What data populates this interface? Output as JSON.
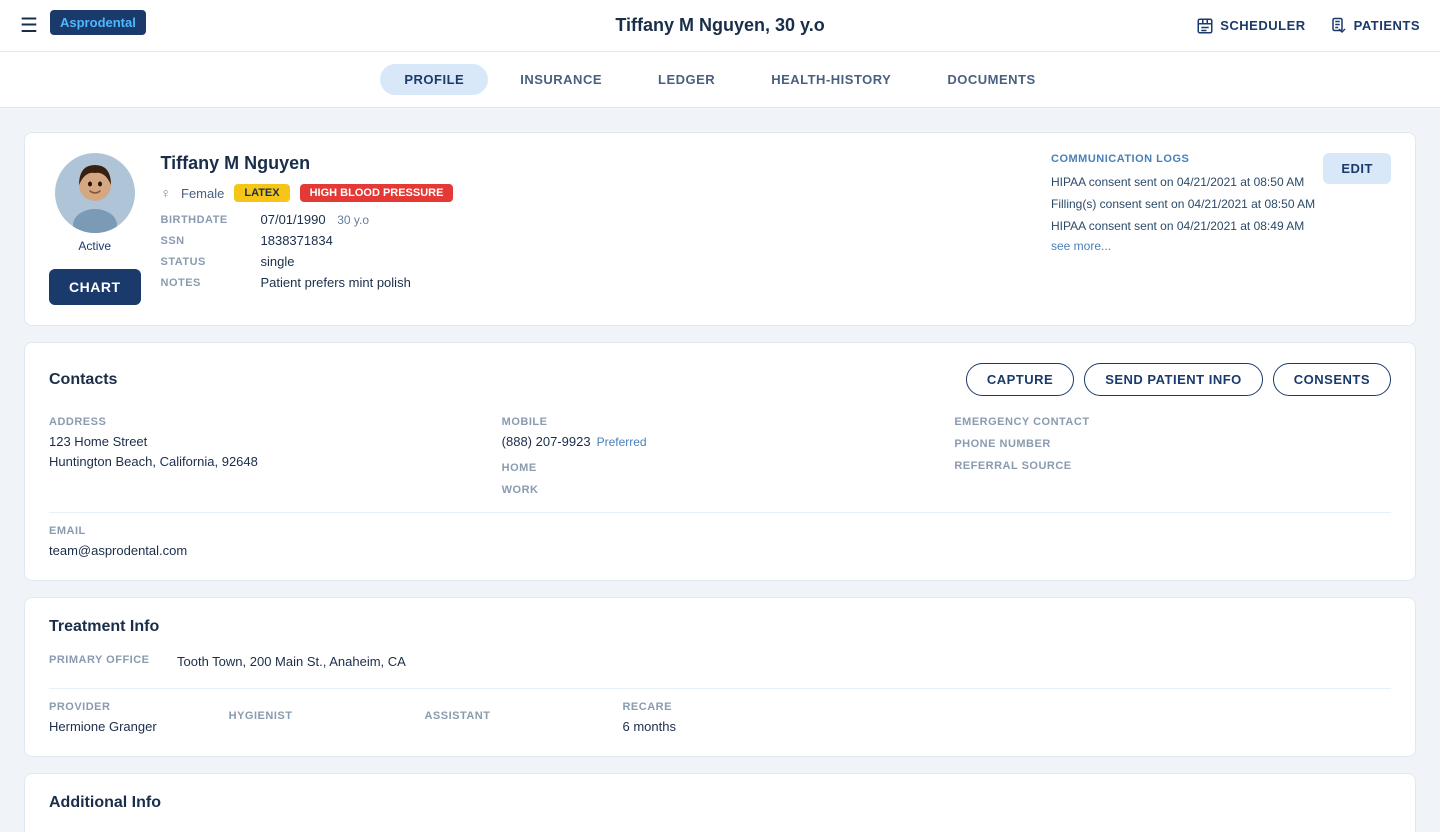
{
  "app": {
    "logo_text": "Aspro",
    "logo_accent": "dental",
    "hamburger_icon": "☰",
    "patient_title": "Tiffany M Nguyen, 30 y.o"
  },
  "nav": {
    "scheduler_label": "SCHEDULER",
    "patients_label": "PATIENTS"
  },
  "tabs": [
    {
      "id": "profile",
      "label": "PROFILE",
      "active": true
    },
    {
      "id": "insurance",
      "label": "INSURANCE",
      "active": false
    },
    {
      "id": "ledger",
      "label": "LEDGER",
      "active": false
    },
    {
      "id": "health-history",
      "label": "HEALTH-HISTORY",
      "active": false
    },
    {
      "id": "documents",
      "label": "DOCUMENTS",
      "active": false
    }
  ],
  "patient": {
    "name": "Tiffany M Nguyen",
    "status": "Active",
    "gender_icon": "♀",
    "gender": "Female",
    "badge_latex": "LATEX",
    "badge_bp": "HIGH BLOOD PRESSURE",
    "birthdate_label": "BIRTHDATE",
    "birthdate": "07/01/1990",
    "age": "30 y.o",
    "ssn_label": "SSN",
    "ssn": "1838371834",
    "status_label": "STATUS",
    "marital_status": "single",
    "notes_label": "NOTES",
    "notes": "Patient prefers mint polish",
    "chart_btn": "CHART"
  },
  "comm_logs": {
    "title": "COMMUNICATION LOGS",
    "logs": [
      "HIPAA consent sent on 04/21/2021 at 08:50 AM",
      "Filling(s) consent sent on 04/21/2021 at 08:50 AM",
      "HIPAA consent sent on 04/21/2021 at 08:49 AM"
    ],
    "see_more": "see more...",
    "edit_btn": "EDIT"
  },
  "contacts": {
    "section_title": "Contacts",
    "capture_btn": "CAPTURE",
    "send_info_btn": "SEND PATIENT INFO",
    "consents_btn": "CONSENTS",
    "address_label": "ADDRESS",
    "address_line1": "123 Home Street",
    "address_line2": "Huntington Beach, California, 92648",
    "email_label": "EMAIL",
    "email": "team@asprodental.com",
    "mobile_label": "MOBILE",
    "mobile": "(888) 207-9923",
    "mobile_preferred": "Preferred",
    "home_label": "HOME",
    "home_value": "",
    "work_label": "WORK",
    "work_value": "",
    "emergency_label": "EMERGENCY CONTACT",
    "emergency_value": "",
    "phone_number_label": "PHONE NUMBER",
    "phone_number_value": "",
    "referral_label": "REFERRAL SOURCE",
    "referral_value": ""
  },
  "treatment": {
    "section_title": "Treatment Info",
    "primary_office_label": "PRIMARY OFFICE",
    "primary_office": "Tooth Town, 200 Main St., Anaheim, CA",
    "provider_label": "PROVIDER",
    "provider": "Hermione Granger",
    "hygienist_label": "HYGIENIST",
    "hygienist": "",
    "assistant_label": "ASSISTANT",
    "assistant": "",
    "recare_label": "RECARE",
    "recare": "6 months"
  },
  "additional": {
    "section_title": "Additional Info"
  },
  "colors": {
    "primary_blue": "#1a3a6b",
    "accent_blue": "#4a80b8",
    "latex_yellow": "#f5c518",
    "bp_red": "#e53935"
  }
}
